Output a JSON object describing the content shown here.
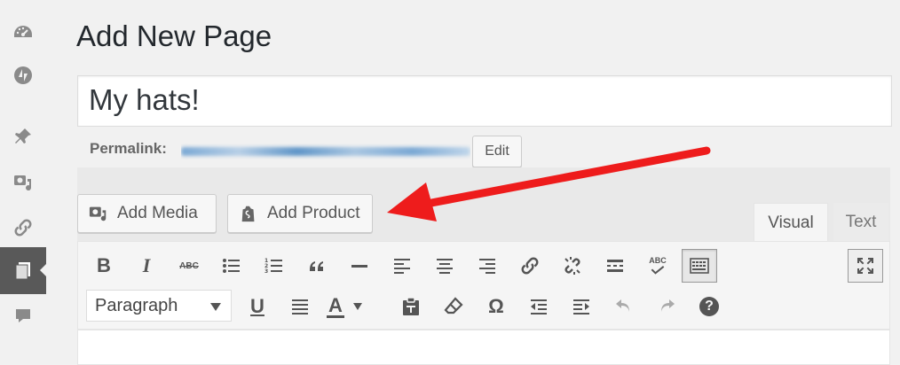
{
  "page": {
    "title": "Add New Page"
  },
  "post_title": {
    "value": "My hats!"
  },
  "permalink": {
    "label": "Permalink:",
    "edit_label": "Edit"
  },
  "media_buttons": {
    "add_media": "Add Media",
    "add_product": "Add Product"
  },
  "editor_tabs": {
    "visual": "Visual",
    "text": "Text"
  },
  "toolbar": {
    "format_select": "Paragraph",
    "row1_icons": [
      "bold-icon",
      "italic-icon",
      "strikethrough-icon",
      "bulleted-list-icon",
      "numbered-list-icon",
      "blockquote-icon",
      "horizontal-line-icon",
      "align-left-icon",
      "align-center-icon",
      "align-right-icon",
      "link-icon",
      "unlink-icon",
      "read-more-icon",
      "spellcheck-icon",
      "toolbar-toggle-icon",
      "fullscreen-icon"
    ],
    "row2_icons": [
      "underline-icon",
      "justify-icon",
      "text-color-icon",
      "paste-as-text-icon",
      "clear-formatting-icon",
      "special-character-icon",
      "outdent-icon",
      "indent-icon",
      "undo-icon",
      "redo-icon",
      "help-icon"
    ],
    "bold_glyph": "B",
    "italic_glyph": "I",
    "strike_glyph": "ABC",
    "spell_glyph": "ABC",
    "underline_glyph": "U",
    "textcolor_glyph": "A",
    "omega_glyph": "Ω",
    "help_glyph": "?"
  },
  "sidebar": {
    "icons": [
      "dashboard-icon",
      "jetpack-icon",
      "pin-icon",
      "media-icon",
      "link-icon",
      "pages-icon",
      "comments-icon"
    ]
  },
  "colors": {
    "accent_arrow": "#ee1c1c",
    "active_menu": "#595959"
  }
}
